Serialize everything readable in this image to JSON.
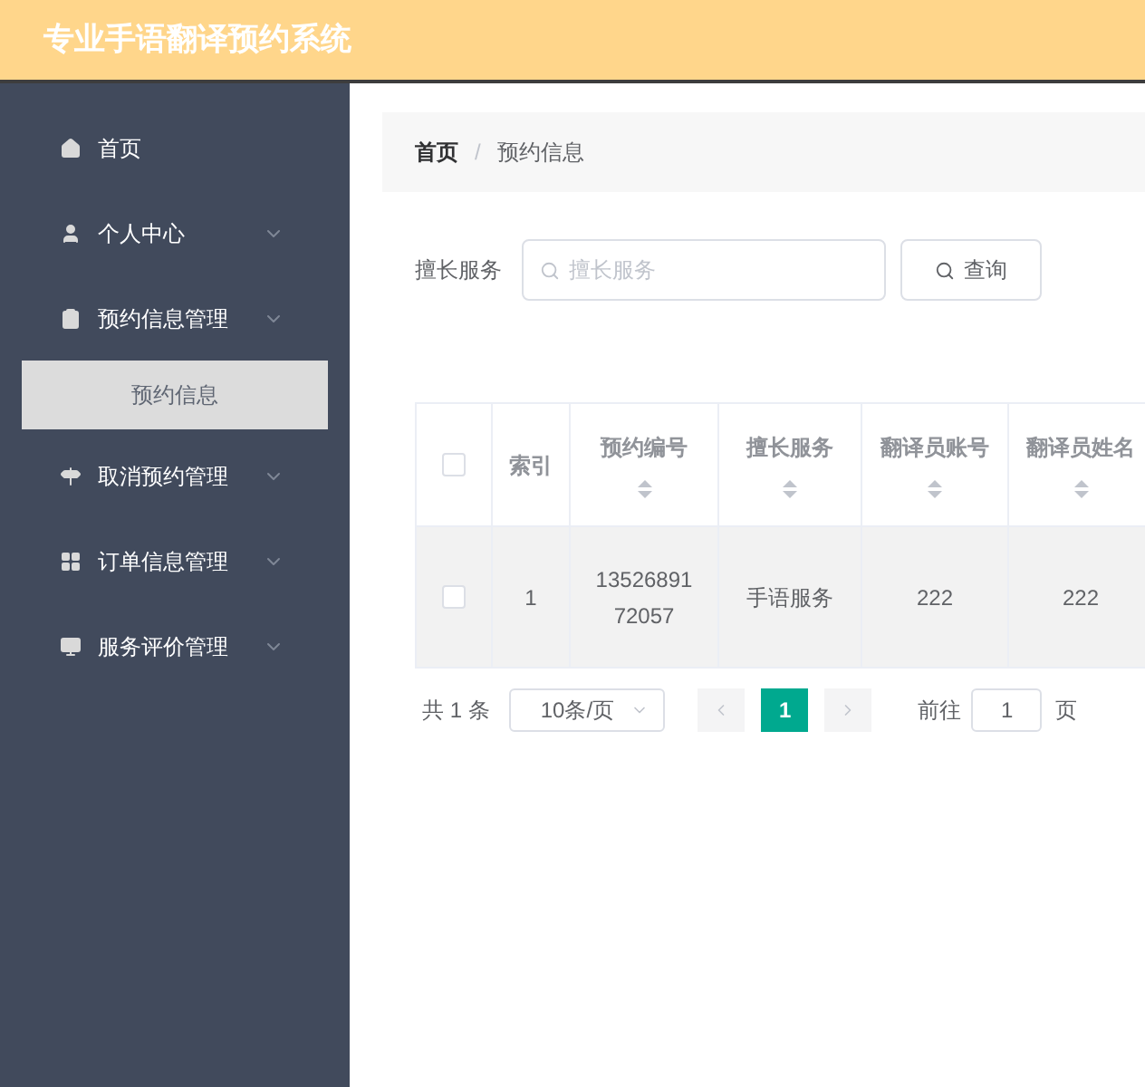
{
  "header": {
    "title": "专业手语翻译预约系统"
  },
  "sidebar": {
    "items": [
      {
        "label": "首页",
        "expandable": false
      },
      {
        "label": "个人中心",
        "expandable": true
      },
      {
        "label": "预约信息管理",
        "expandable": true,
        "children": [
          {
            "label": "预约信息",
            "selected": true
          }
        ]
      },
      {
        "label": "取消预约管理",
        "expandable": true
      },
      {
        "label": "订单信息管理",
        "expandable": true
      },
      {
        "label": "服务评价管理",
        "expandable": true
      }
    ]
  },
  "breadcrumb": [
    {
      "label": "首页",
      "current": false
    },
    {
      "separator": "/",
      "label": "预约信息",
      "current": true
    }
  ],
  "search": {
    "label": "擅长服务",
    "placeholder": "擅长服务",
    "button": "查询"
  },
  "table": {
    "select_all_checked": false,
    "columns": [
      {
        "label": "索引",
        "sortable": false
      },
      {
        "label": "预约编号",
        "sortable": true
      },
      {
        "label": "擅长服务",
        "sortable": true
      },
      {
        "label": "翻译员账号",
        "sortable": true
      },
      {
        "label": "翻译员姓名",
        "sortable": true
      }
    ],
    "rows": [
      {
        "checked": false,
        "cells": [
          "1",
          "1352689172057",
          "手语服务",
          "222",
          "222"
        ]
      }
    ]
  },
  "pagination": {
    "total": "共 1 条",
    "page_size": "10条/页",
    "pages": [
      {
        "label": "1",
        "selected": true
      }
    ],
    "goto_label": "前往",
    "goto_value": "1",
    "goto_suffix": "页"
  }
}
